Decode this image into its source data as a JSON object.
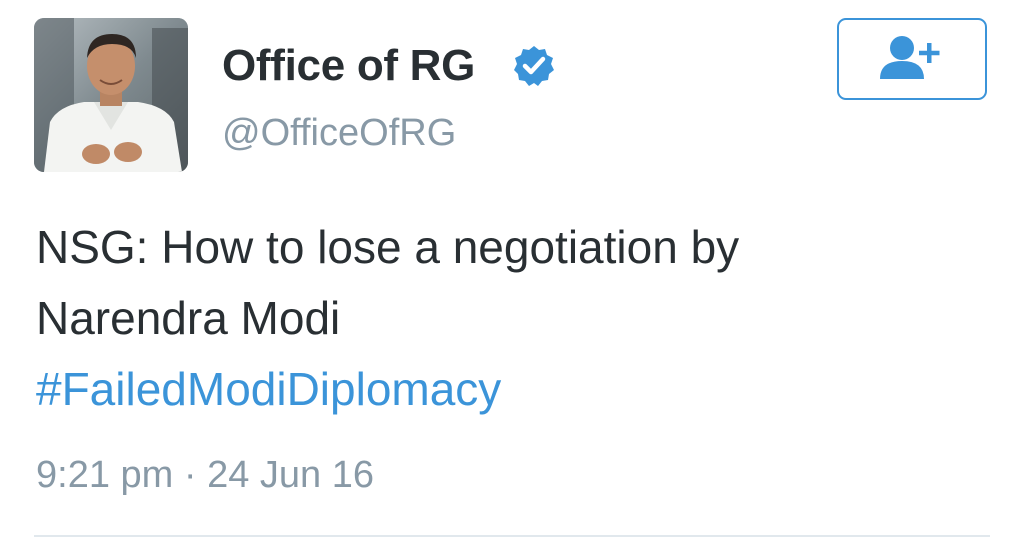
{
  "tweet": {
    "author": {
      "display_name": "Office of RG",
      "handle": "@OfficeOfRG",
      "verified": true,
      "avatar_icon": "profile-photo"
    },
    "follow_button": {
      "icon": "add-user-icon"
    },
    "text_lines": [
      "NSG: How to lose a negotiation by",
      "Narendra Modi"
    ],
    "hashtag": "#FailedModiDiplomacy",
    "timestamp": "9:21 pm · 24 Jun 16"
  },
  "colors": {
    "accent": "#3b94d9",
    "text": "#292f33",
    "muted": "#8899a6",
    "divider": "#e1e8ed"
  }
}
